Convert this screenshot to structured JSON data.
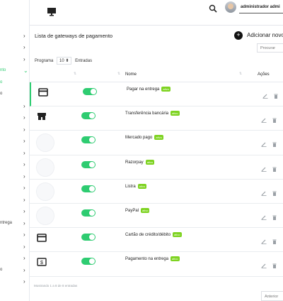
{
  "sidebar": {
    "rows": [
      {
        "label": "",
        "chevron": ""
      },
      {
        "label": "",
        "chevron": "›"
      },
      {
        "label": "",
        "chevron": "›"
      },
      {
        "label": "",
        "chevron": "›"
      },
      {
        "label": "nto",
        "chevron": "⌄",
        "active": true
      },
      {
        "label": "o",
        "chevron": "",
        "active": true
      },
      {
        "label": "o",
        "chevron": ""
      },
      {
        "label": "",
        "chevron": "›"
      },
      {
        "label": "",
        "chevron": "›"
      },
      {
        "label": "",
        "chevron": "›"
      },
      {
        "label": "",
        "chevron": "›"
      },
      {
        "label": "",
        "chevron": "›"
      },
      {
        "label": "",
        "chevron": "›"
      },
      {
        "label": "",
        "chevron": "›"
      },
      {
        "label": "",
        "chevron": "›"
      },
      {
        "label": "",
        "chevron": "›"
      },
      {
        "label": "",
        "chevron": "›"
      },
      {
        "label": "ntrega",
        "chevron": "›"
      },
      {
        "label": "",
        "chevron": "›"
      },
      {
        "label": "",
        "chevron": "›"
      },
      {
        "label": "",
        "chevron": "›"
      },
      {
        "label": "o",
        "chevron": "›"
      },
      {
        "label": "",
        "chevron": "›"
      }
    ]
  },
  "topbar": {
    "user_name": "administrador admi",
    "icons": [
      "monitor-icon",
      "search-icon"
    ]
  },
  "page": {
    "title": "Lista de gateways de pagamento",
    "add_button_label": "Adicionar novo",
    "add_button_icon": "+",
    "search_placeholder": "Procurar",
    "length_prefix": "Programa",
    "length_value": "10",
    "length_caret": "⬍",
    "length_suffix": "Entradas"
  },
  "table": {
    "headers": {
      "name": "Nome",
      "actions": "Ações"
    },
    "rows": [
      {
        "icon": "card-icon",
        "name": "Pagar na entrega",
        "badge": "ativo"
      },
      {
        "icon": "store-icon",
        "name": "Transferência bancária",
        "badge": "ativo"
      },
      {
        "icon": "placeholder",
        "name": "Mercado pago",
        "badge": "ativo"
      },
      {
        "icon": "placeholder",
        "name": "Razorpay",
        "badge": "ativo"
      },
      {
        "icon": "placeholder",
        "name": "Listra",
        "badge": "ativo"
      },
      {
        "icon": "placeholder",
        "name": "PayPal",
        "badge": "ativo"
      },
      {
        "icon": "card-icon",
        "name": "Cartão de crédito/débito",
        "badge": "ativo"
      },
      {
        "icon": "cash-icon",
        "name": "Pagamento na entrega",
        "badge": "ativo"
      }
    ]
  },
  "footer": {
    "info": "Mostrando 1 a 8 de 8 entradas",
    "prev_label": "Anterior"
  },
  "colors": {
    "accent": "#2ecc71",
    "badge": "#7ed321"
  }
}
